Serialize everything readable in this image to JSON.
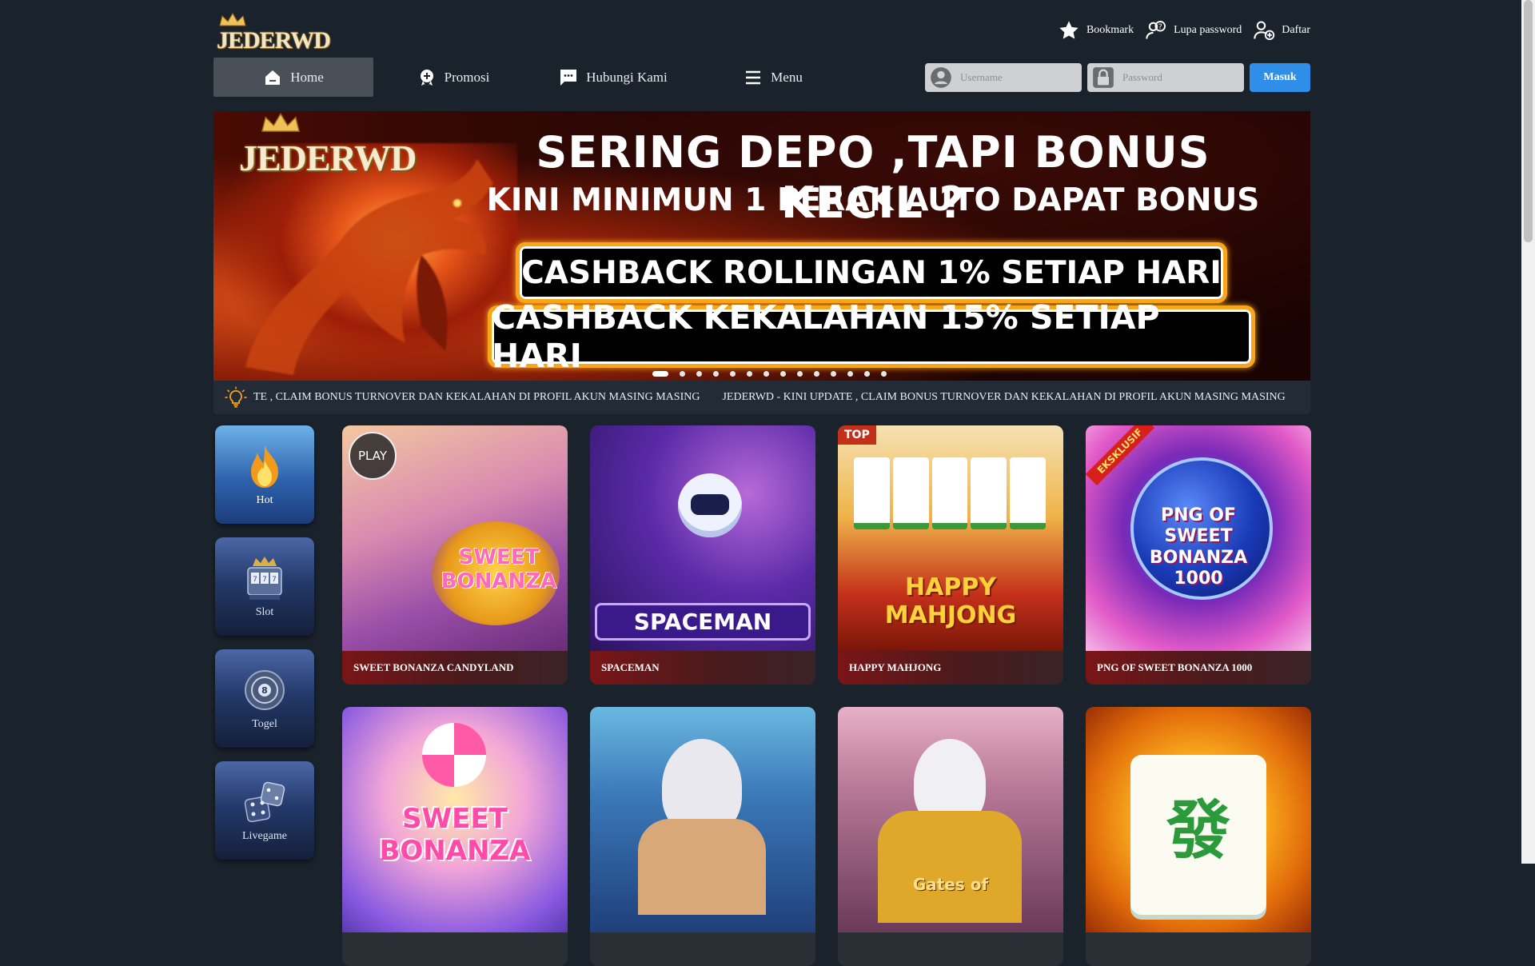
{
  "header": {
    "logo_text": "JEDERWD",
    "links": [
      {
        "label": "Bookmark",
        "icon": "star-icon"
      },
      {
        "label": "Lupa password",
        "icon": "user-question-icon"
      },
      {
        "label": "Daftar",
        "icon": "user-add-icon"
      }
    ]
  },
  "nav": {
    "items": [
      {
        "label": "Home",
        "icon": "home-icon",
        "active": true
      },
      {
        "label": "Promosi",
        "icon": "promo-badge-icon",
        "active": false
      },
      {
        "label": "Hubungi Kami",
        "icon": "chat-icon",
        "active": false
      },
      {
        "label": "Menu",
        "icon": "hamburger-icon",
        "active": false
      }
    ]
  },
  "login": {
    "username_placeholder": "Username",
    "password_placeholder": "Password",
    "submit_label": "Masuk"
  },
  "banner": {
    "logo_text": "JEDERWD",
    "line1": "SERING DEPO ,TAPI BONUS KECIL ?",
    "line2": "KINI MINIMUN 1 PERAK AUTO DAPAT BONUS",
    "box1": "CASHBACK ROLLINGAN 1% SETIAP HARI",
    "box2": "CASHBACK KEKALAHAN 15% SETIAP HARI",
    "slide_count": 14,
    "active_slide": 1
  },
  "marquee": {
    "text_partial": "TE , CLAIM BONUS TURNOVER DAN KEKALAHAN DI PROFIL AKUN MASING MASING",
    "text_full": "JEDERWD - KINI UPDATE , CLAIM BONUS TURNOVER DAN KEKALAHAN DI PROFIL AKUN MASING MASING"
  },
  "categories": [
    {
      "label": "Hot",
      "icon": "fire-icon",
      "active": true
    },
    {
      "label": "Slot",
      "icon": "slot-machine-icon",
      "active": false
    },
    {
      "label": "Togel",
      "icon": "lottery-ball-icon",
      "active": false
    },
    {
      "label": "Livegame",
      "icon": "dice-icon",
      "active": false
    }
  ],
  "games": [
    {
      "title": "SWEET BONANZA CANDYLAND",
      "art_text": "SWEET BONANZA",
      "badge": "PLAY"
    },
    {
      "title": "SPACEMAN",
      "art_text": "SPACEMAN",
      "badge": ""
    },
    {
      "title": "HAPPY MAHJONG",
      "art_text": "HAPPY MAHJONG",
      "badge": "TOP"
    },
    {
      "title": "PNG OF SWEET BONANZA 1000",
      "art_text": "PNG OF SWEET BONANZA 1000",
      "badge": "EKSKLUSIF"
    },
    {
      "title": "",
      "art_text": "SWEET BONANZA",
      "badge": ""
    },
    {
      "title": "",
      "art_text": "",
      "badge": ""
    },
    {
      "title": "",
      "art_text": "Gates of",
      "badge": ""
    },
    {
      "title": "",
      "art_text": "發",
      "badge": ""
    }
  ],
  "colors": {
    "background": "#1a222b",
    "accent_button": "#2f8fe8",
    "nav_active": "#4a5058",
    "banner_box_border": "#f7a51b",
    "game_title_bar": "#7a1517"
  }
}
